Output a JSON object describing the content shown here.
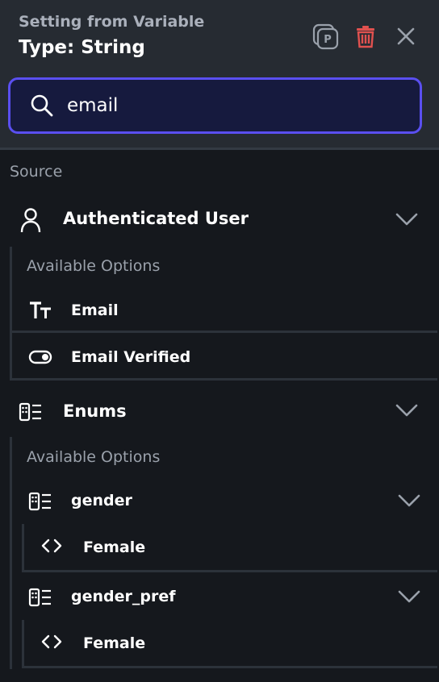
{
  "header": {
    "title": "Setting from Variable",
    "type_label": "Type: String",
    "actions": [
      "parameter-icon",
      "trash-icon",
      "close-icon"
    ],
    "accent_color": "#5a4ff0",
    "delete_color": "#e0514f"
  },
  "search": {
    "value": "email"
  },
  "source": {
    "label": "Source",
    "groups": [
      {
        "name": "Authenticated User",
        "icon": "user-icon",
        "options_label": "Available Options",
        "options": [
          {
            "label": "Email",
            "icon": "text-type-icon"
          },
          {
            "label": "Email Verified",
            "icon": "toggle-icon"
          }
        ]
      },
      {
        "name": "Enums",
        "icon": "enum-icon",
        "options_label": "Available Options",
        "enums": [
          {
            "name": "gender",
            "icon": "enum-icon",
            "values": [
              "Female"
            ]
          },
          {
            "name": "gender_pref",
            "icon": "enum-icon",
            "values": [
              "Female"
            ]
          }
        ]
      }
    ]
  }
}
